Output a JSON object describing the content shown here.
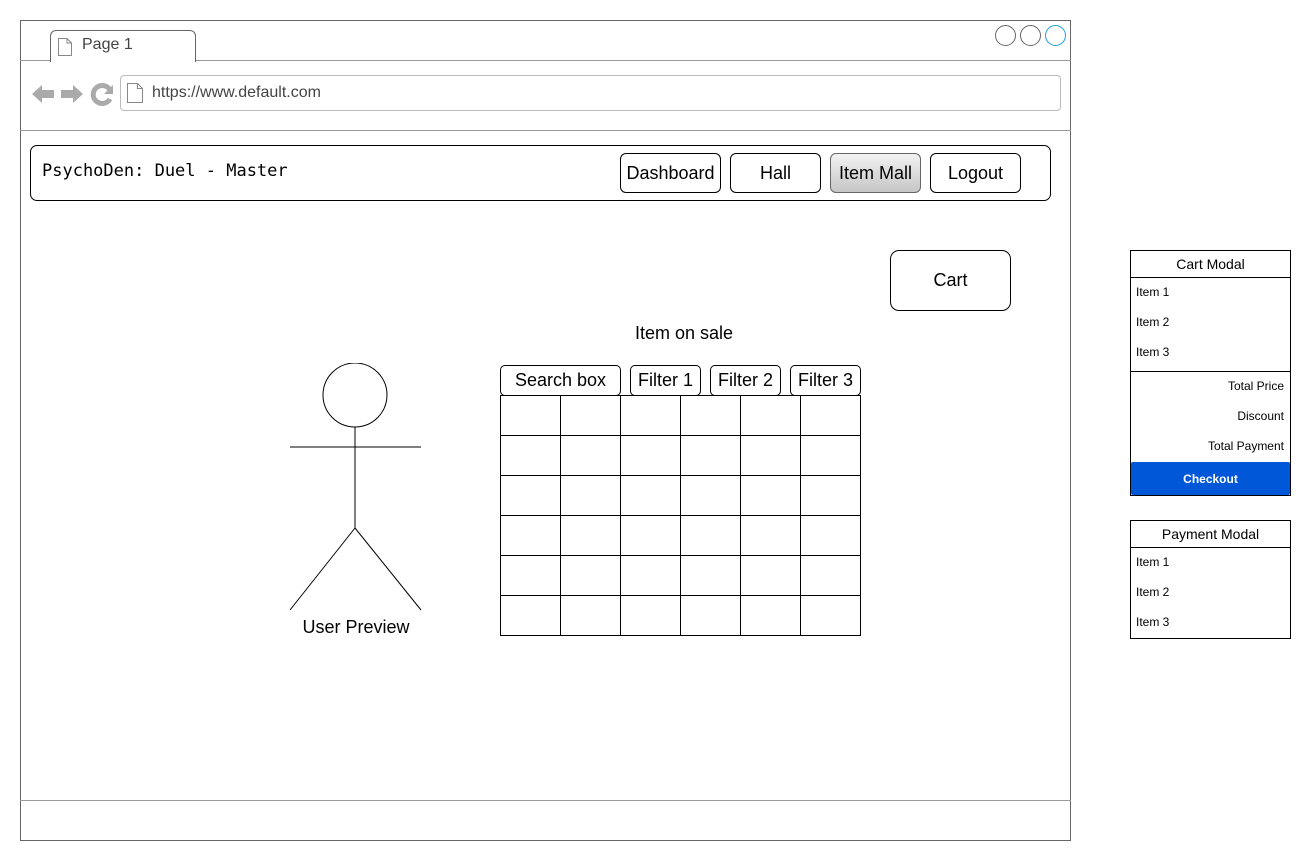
{
  "browser": {
    "tab_label": "Page 1",
    "url": "https://www.default.com",
    "accent_color": "#1ba1e2"
  },
  "app": {
    "title": "PsychoDen: Duel - Master",
    "nav": [
      {
        "label": "Dashboard",
        "active": false
      },
      {
        "label": "Hall",
        "active": false
      },
      {
        "label": "Item Mall",
        "active": true
      },
      {
        "label": "Logout",
        "active": false
      }
    ]
  },
  "main": {
    "cart_label": "Cart",
    "user_preview_label": "User Preview",
    "items_title": "Item on sale",
    "search_label": "Search box",
    "filters": [
      "Filter 1",
      "Filter 2",
      "Filter 3"
    ],
    "grid": {
      "rows": 6,
      "cols": 6
    }
  },
  "cart_modal": {
    "title": "Cart Modal",
    "items": [
      "Item 1",
      "Item 2",
      "Item 3"
    ],
    "summary": [
      "Total Price",
      "Discount",
      "Total Payment"
    ],
    "checkout_label": "Checkout",
    "checkout_color": "#0057d8"
  },
  "payment_modal": {
    "title": "Payment Modal",
    "items": [
      "Item 1",
      "Item 2",
      "Item 3"
    ]
  }
}
